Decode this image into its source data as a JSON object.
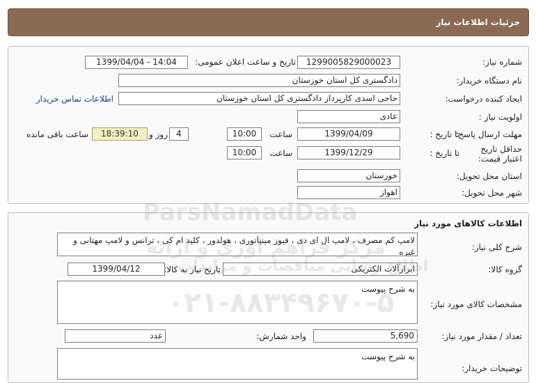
{
  "header": {
    "title": "جزئیات اطلاعات نیاز"
  },
  "general": {
    "need_number_label": "شماره نیاز:",
    "need_number": "1299005829000023",
    "announce_label": "تاریخ و ساعت اعلان عمومی:",
    "announce_value": "1399/04/04 - 14:04",
    "buyer_org_label": "نام دستگاه خریدار:",
    "buyer_org": "دادگستری کل استان خوزستان",
    "creator_label": "ایجاد کننده درخواست:",
    "creator": "حاجی اسدی کارپرداز دادگستری کل استان خوزستان",
    "contact_link": "اطلاعات تماس خریدار",
    "priority_label": "اولویت نیاز :",
    "priority": "عادی",
    "deadline_label": "مهلت ارسال پاسخ:",
    "until_label": "تا تاریخ :",
    "deadline_date": "1399/04/09",
    "time_label": "ساعت",
    "deadline_time": "10:00",
    "days_value": "4",
    "days_label": "روز و",
    "remaining_time": "18:39:10",
    "remaining_label": "ساعت باقی مانده",
    "price_validity_label": "حداقل تاریخ اعتبار قیمت:",
    "validity_until_label": "تا تاریخ :",
    "validity_date": "1399/12/29",
    "validity_time_label": "ساعت",
    "validity_time": "10:00",
    "province_label": "استان محل تحویل:",
    "province": "خوزستان",
    "city_label": "شهر محل تحویل:",
    "city": "اهواز"
  },
  "goods": {
    "section_title": "اطلاعات کالاهای مورد نیاز",
    "description_label": "شرح کلی نیاز:",
    "description": "لامپ کم مصرف ، لامپ ال ای دی ، فیوز مینیاتوری ، هولدور ، کلید ام کی ، ترانس و لامپ مهتابی و غیره",
    "group_label": "گروه کالا:",
    "group": "ابزارآلات الکتریکی",
    "need_date_label": "تاریخ نیاز به کالا:",
    "need_date": "1399/04/12",
    "specs_label": "مشخصات کالای مورد نیاز:",
    "specs": "به شرح پیوست",
    "quantity_label": "تعداد / مقدار مورد نیاز:",
    "quantity": "5,690",
    "unit_label": "واحد شمارش:",
    "unit": "عدد",
    "buyer_notes_label": "توضیحات خریدار:",
    "buyer_notes": "به شرح پیوست"
  },
  "watermark": {
    "brand": "ParsNamadData",
    "line1": "مرکز فراهم آوری و ارائه",
    "line2": "اطلاع رسانی مناقصات و مزایدات",
    "phone": "۰۲۱-۸۸۳۴۹۶۷۰-۵"
  }
}
